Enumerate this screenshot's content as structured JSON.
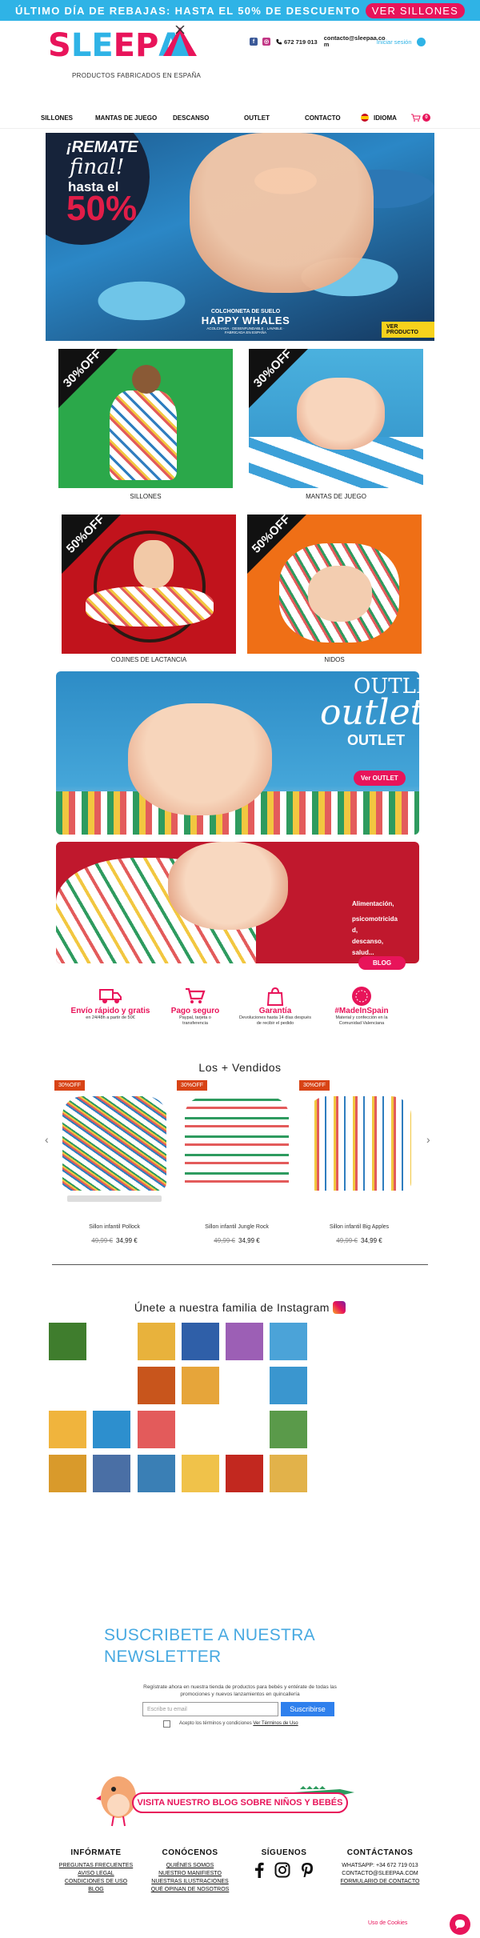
{
  "banner": {
    "message": "ÚLTIMO DÍA DE REBAJAS: HASTA EL 50% DE DESCUENTO",
    "cta": "VER SILLONES"
  },
  "header": {
    "logo_letters": [
      "S",
      "L",
      "E",
      "E",
      "P",
      "A"
    ],
    "tagline": "PRODUCTOS FABRICADOS EN ESPAÑA",
    "phone": "672 719 013",
    "email": "contacto@sleepaa.co m",
    "login": "Iniciar sesión"
  },
  "nav": {
    "items": [
      "SILLONES",
      "MANTAS DE JUEGO",
      "DESCANSO",
      "OUTLET",
      "CONTACTO"
    ],
    "language": "IDIOMA",
    "cart_count": "0"
  },
  "hero": {
    "line1": "¡REMATE",
    "line2": "final!",
    "line3": "hasta el",
    "line4": "50%",
    "product_kicker": "COLCHONETA DE SUELO",
    "product_name": "HAPPY WHALES",
    "product_note": "ACOLCHADA · DESENFUNDABLE · LAVABLE · FABRICADA EN ESPAÑA",
    "cta": "VER PRODUCTO"
  },
  "categories": [
    {
      "label": "SILLONES",
      "discount": "30%OFF"
    },
    {
      "label": "MANTAS DE JUEGO",
      "discount": "30%OFF"
    },
    {
      "label": "COJINES DE LACTANCIA",
      "discount": "50%OFF"
    },
    {
      "label": "NIDOS",
      "discount": "50%OFF"
    }
  ],
  "outlet": {
    "word1": "OUTLET",
    "word2": "outlet",
    "word3": "OUTLET",
    "cta": "Ver OUTLET"
  },
  "blog_banner": {
    "lines": [
      "Alimentación,",
      "psicomotricida",
      "d,",
      "descanso,",
      "salud..."
    ],
    "cta": "BLOG"
  },
  "features": [
    {
      "title": "Envío rápido y gratis",
      "desc": "en 24/48h a partir de 50€"
    },
    {
      "title": "Pago seguro",
      "desc": "Paypal, tarjeta o transferencia"
    },
    {
      "title": "Garantía",
      "desc": "Devoluciones hasta 14 días después de recibir el pedido"
    },
    {
      "title": "#MadeInSpain",
      "desc": "Material y confección en la Comunidad Valenciana"
    }
  ],
  "best_sellers": {
    "title": "Los + Vendidos",
    "items": [
      {
        "badge": "30%OFF",
        "name": "Sillon infantil Pollock",
        "old_price": "49,99 €",
        "price": "34,99 €"
      },
      {
        "badge": "30%OFF",
        "name": "Sillon infantil Jungle Rock",
        "old_price": "49,99 €",
        "price": "34,99 €"
      },
      {
        "badge": "30%OFF",
        "name": "Sillon infantil Big Apples",
        "old_price": "49,99 €",
        "price": "34,99 €"
      }
    ]
  },
  "instagram": {
    "title": "Únete a nuestra familia de Instagram"
  },
  "newsletter": {
    "title": "SUSCRIBETE A NUESTRA NEWSLETTER",
    "text": "Regístrate ahora en nuestra tienda de productos para bebés y entérate de todas las promociones y nuevos lanzamientos en quincallería",
    "placeholder": "Escribe tu email",
    "button": "Suscribirse",
    "terms_prefix": "Acepto los términos y condiciones ",
    "terms_link": "Ver Términos de Uso"
  },
  "blog_visit": {
    "text": "VISITA NUESTRO BLOG SOBRE NIÑOS Y BEBÉS"
  },
  "footer": {
    "informate": {
      "title": "INFÓRMATE",
      "links": [
        "PREGUNTAS FRECUENTES",
        "AVISO LEGAL",
        "CONDICIONES DE USO",
        "BLOG"
      ]
    },
    "conocenos": {
      "title": "CONÓCENOS",
      "links": [
        "QUIÉNES SOMOS",
        "NUESTRO MANIFIESTO",
        "NUESTRAS ILUSTRACIONES",
        "QUÉ OPINAN DE NOSOTROS"
      ]
    },
    "siguenos": {
      "title": "SÍGUENOS"
    },
    "contactanos": {
      "title": "CONTÁCTANOS",
      "links": [
        "WHATSAPP: +34 672 719 013",
        "CONTACTO@SLEEPAA.COM",
        "FORMULARIO DE CONTACTO"
      ]
    },
    "cookies": "Uso de Cookies"
  },
  "colors": {
    "accent": "#e8145a",
    "brand_blue": "#2fb3e6",
    "button_blue": "#2f80ed"
  },
  "icons": [
    "facebook-icon",
    "instagram-icon",
    "phone-icon",
    "mail-icon",
    "user-icon",
    "cart-icon",
    "flag-icon",
    "truck-icon",
    "cart-pay-icon",
    "bag-icon",
    "badge-icon",
    "pinterest-icon",
    "chat-icon"
  ]
}
